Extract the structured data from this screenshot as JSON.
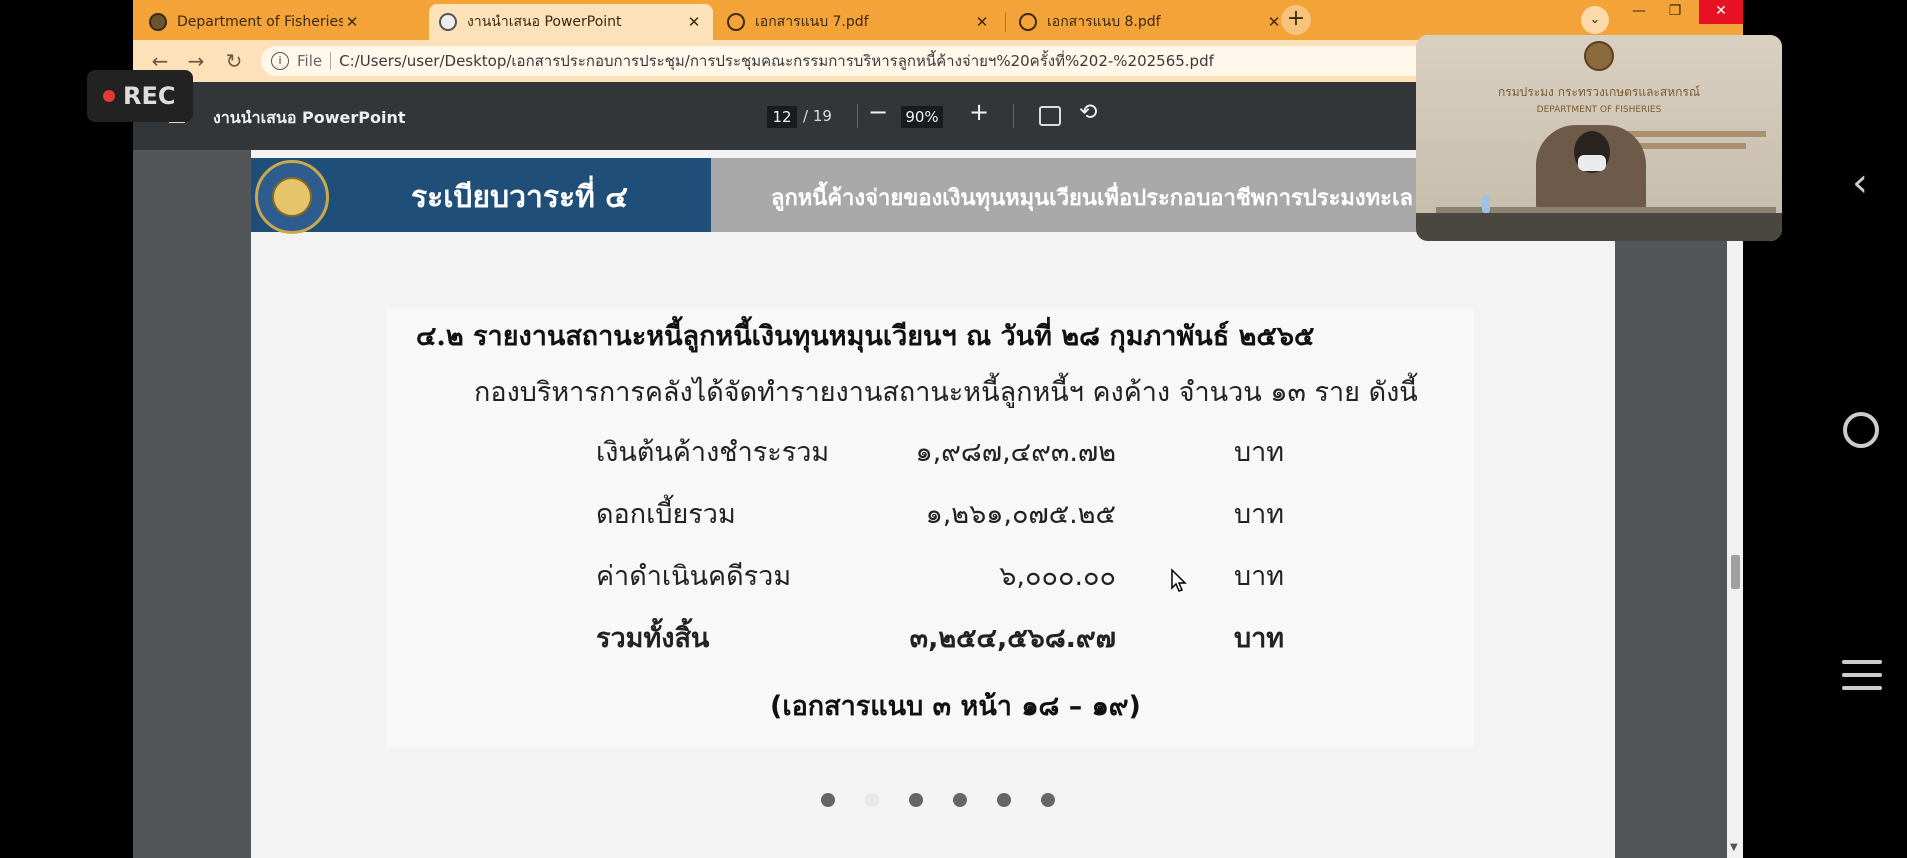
{
  "tabs": [
    {
      "title": "Department of Fisheries | กรมประ",
      "active": false
    },
    {
      "title": "งานนำเสนอ PowerPoint",
      "active": true
    },
    {
      "title": "เอกสารแนบ 7.pdf",
      "active": false
    },
    {
      "title": "เอกสารแนบ 8.pdf",
      "active": false
    }
  ],
  "address": {
    "scheme_label": "File",
    "url": "C:/Users/user/Desktop/เอกสารประกอบการประชุม/การประชุมคณะกรรมการบริหารลูกหนี้ค้างจ่ายฯ%20ครั้งที่%202-%202565.pdf"
  },
  "pdf_toolbar": {
    "title": "งานนำเสนอ PowerPoint",
    "page_current": "12",
    "page_total": "/ 19",
    "zoom": "90%"
  },
  "slide": {
    "header_title": "ระเบียบวาระที่ ๔",
    "header_subtitle": "ลูกหนี้ค้างจ่ายของเงินทุนหมุนเวียนเพื่อประกอบอาชีพการประมงทะเล ห",
    "section_title": "๔.๒ รายงานสถานะหนี้ลูกหนี้เงินทุนหมุนเวียนฯ ณ วันที่ ๒๘ กุมภาพันธ์ ๒๕๖๕",
    "intro": "กองบริหารการคลังได้จัดทำรายงานสถานะหนี้ลูกหนี้ฯ คงค้าง จำนวน ๑๓ ราย ดังนี้",
    "rows": [
      {
        "label": "เงินต้นค้างชำระรวม",
        "amount": "๑,๙๘๗,๔๙๓.๗๒",
        "unit": "บาท"
      },
      {
        "label": "ดอกเบี้ยรวม",
        "amount": "๑,๒๖๑,๐๗๕.๒๕",
        "unit": "บาท"
      },
      {
        "label": "ค่าดำเนินคดีรวม",
        "amount": "๖,๐๐๐.๐๐",
        "unit": "บาท"
      },
      {
        "label": "รวมทั้งสิ้น",
        "amount": "๓,๒๕๔,๕๖๘.๙๗",
        "unit": "บาท"
      }
    ],
    "reference": "(เอกสารแนบ ๓ หน้า ๑๘ – ๑๙)"
  },
  "carousel": {
    "count": 6,
    "active_index": 1
  },
  "recording": {
    "label": "REC"
  },
  "video": {
    "line1": "กรมประมง กระทรวงเกษตรและสหกรณ์",
    "line2": "DEPARTMENT OF FISHERIES"
  },
  "colors": {
    "tab_bar": "#f4a338",
    "slide_header_blue": "#1f4e79",
    "slide_header_gray": "#a9a9a9"
  }
}
